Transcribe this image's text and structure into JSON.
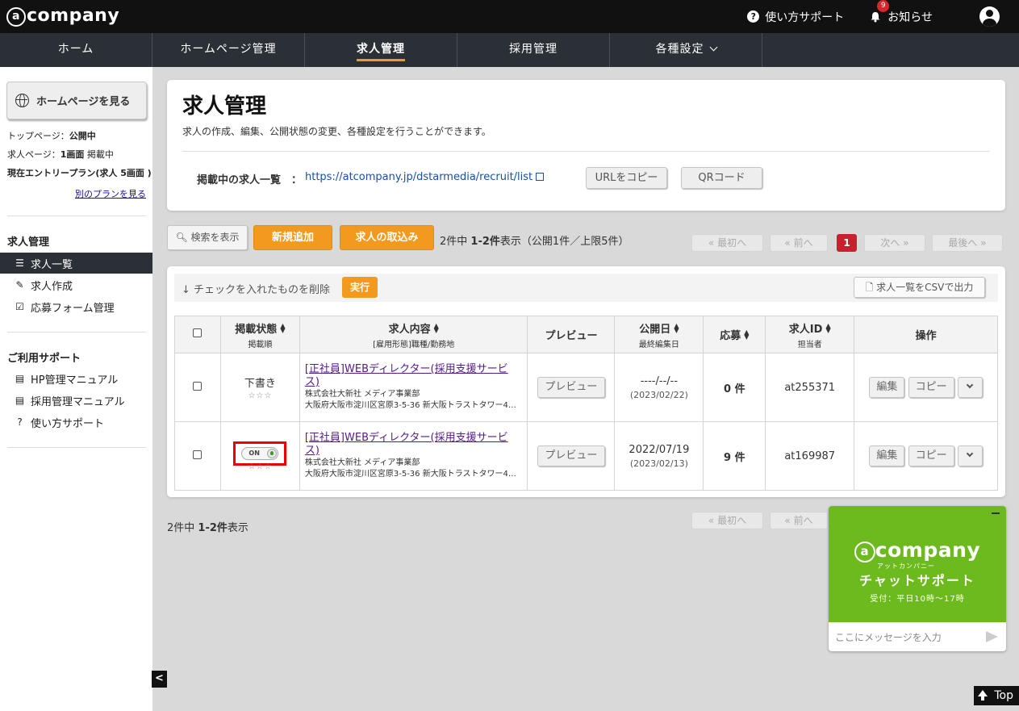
{
  "app": {
    "logo": "company"
  },
  "header": {
    "help_label": "使い方サポート",
    "notice_label": "お知らせ",
    "notice_count": "9"
  },
  "nav": {
    "items": [
      {
        "label": "ホーム"
      },
      {
        "label": "ホームページ管理"
      },
      {
        "label": "求人管理"
      },
      {
        "label": "採用管理"
      },
      {
        "label": "各種設定"
      }
    ]
  },
  "sidebar": {
    "hp_button": "ホームページを見る",
    "top_page_label": "トップページ：",
    "top_page_value": "公開中",
    "job_page_label": "求人ページ：",
    "job_page_value": "1画面",
    "job_page_suffix": " 掲載中",
    "plan_label": "現在エントリープラン(求人 5画面 )",
    "other_plan_link": "別のプランを見る",
    "section_jobs": "求人管理",
    "job_items": [
      {
        "label": "求人一覧"
      },
      {
        "label": "求人作成"
      },
      {
        "label": "応募フォーム管理"
      }
    ],
    "section_support": "ご利用サポート",
    "support_items": [
      {
        "label": "HP管理マニュアル"
      },
      {
        "label": "採用管理マニュアル"
      },
      {
        "label": "使い方サポート"
      }
    ]
  },
  "page": {
    "title": "求人管理",
    "description": "求人の作成、編集、公開状態の変更、各種設定を行うことができます。",
    "listing_label": "掲載中の求人一覧　：",
    "listing_url": "https://atcompany.jp/dstarmedia/recruit/list",
    "copy_url_button": "URLをコピー",
    "qr_button": "QRコード"
  },
  "toolbar": {
    "search_button": "検索を表示",
    "new_button": "新規追加",
    "import_button": "求人の取込み",
    "count_prefix": "2件中",
    "count_range": "1-2件",
    "count_suffix": "表示（公開1件／上限5件）",
    "pager": {
      "first": "« 最初へ",
      "prev": "« 前へ",
      "current": "1",
      "next": "次へ »",
      "last": "最後へ »"
    }
  },
  "bulk": {
    "label": "チェックを入れたものを削除",
    "execute_button": "実行",
    "csv_button": "求人一覧をCSVで出力"
  },
  "table": {
    "headers": {
      "status": "掲載状態",
      "status_sub": "掲載順",
      "content": "求人内容",
      "content_sub": "[雇用形態]職種/勤務地",
      "preview": "プレビュー",
      "date": "公開日",
      "date_sub": "最終編集日",
      "applications": "応募",
      "job_id": "求人ID",
      "job_id_sub": "担当者",
      "actions": "操作"
    },
    "rows": [
      {
        "status": "下書き",
        "stars": "☆☆☆",
        "title": "[正社員]WEBディレクター(採用支援サービス)",
        "company": "株式会社大新社 メディア事業部",
        "address": "大阪府大阪市淀川区宮原3-5-36 新大阪トラストタワー4…",
        "preview_button": "プレビュー",
        "published": "----/--/--",
        "edited": "(2023/02/22)",
        "applications": "0 件",
        "job_id": "at255371",
        "edit_button": "編集",
        "copy_button": "コピー"
      },
      {
        "status_toggle": "ON",
        "stars": "☆☆☆",
        "title": "[正社員]WEBディレクター(採用支援サービス)",
        "company": "株式会社大新社 メディア事業部",
        "address": "大阪府大阪市淀川区宮原3-5-36 新大阪トラストタワー4…",
        "preview_button": "プレビュー",
        "published": "2022/07/19",
        "edited": "(2023/02/13)",
        "applications": "9 件",
        "job_id": "at169987",
        "edit_button": "編集",
        "copy_button": "コピー"
      }
    ]
  },
  "footer_count": {
    "prefix": "2件中",
    "range": "1-2件",
    "suffix": "表示"
  },
  "chat": {
    "logo": "company",
    "kana": "アットカンパニー",
    "title": "チャットサポート",
    "hours": "受付：平日10時～17時",
    "placeholder": "ここにメッセージを入力"
  },
  "top_button": "Top",
  "colors": {
    "accent": "#f39a1e",
    "nav_bg": "#2b2f36",
    "chat_green": "#6dba1e",
    "badge_red": "#d9262c"
  }
}
